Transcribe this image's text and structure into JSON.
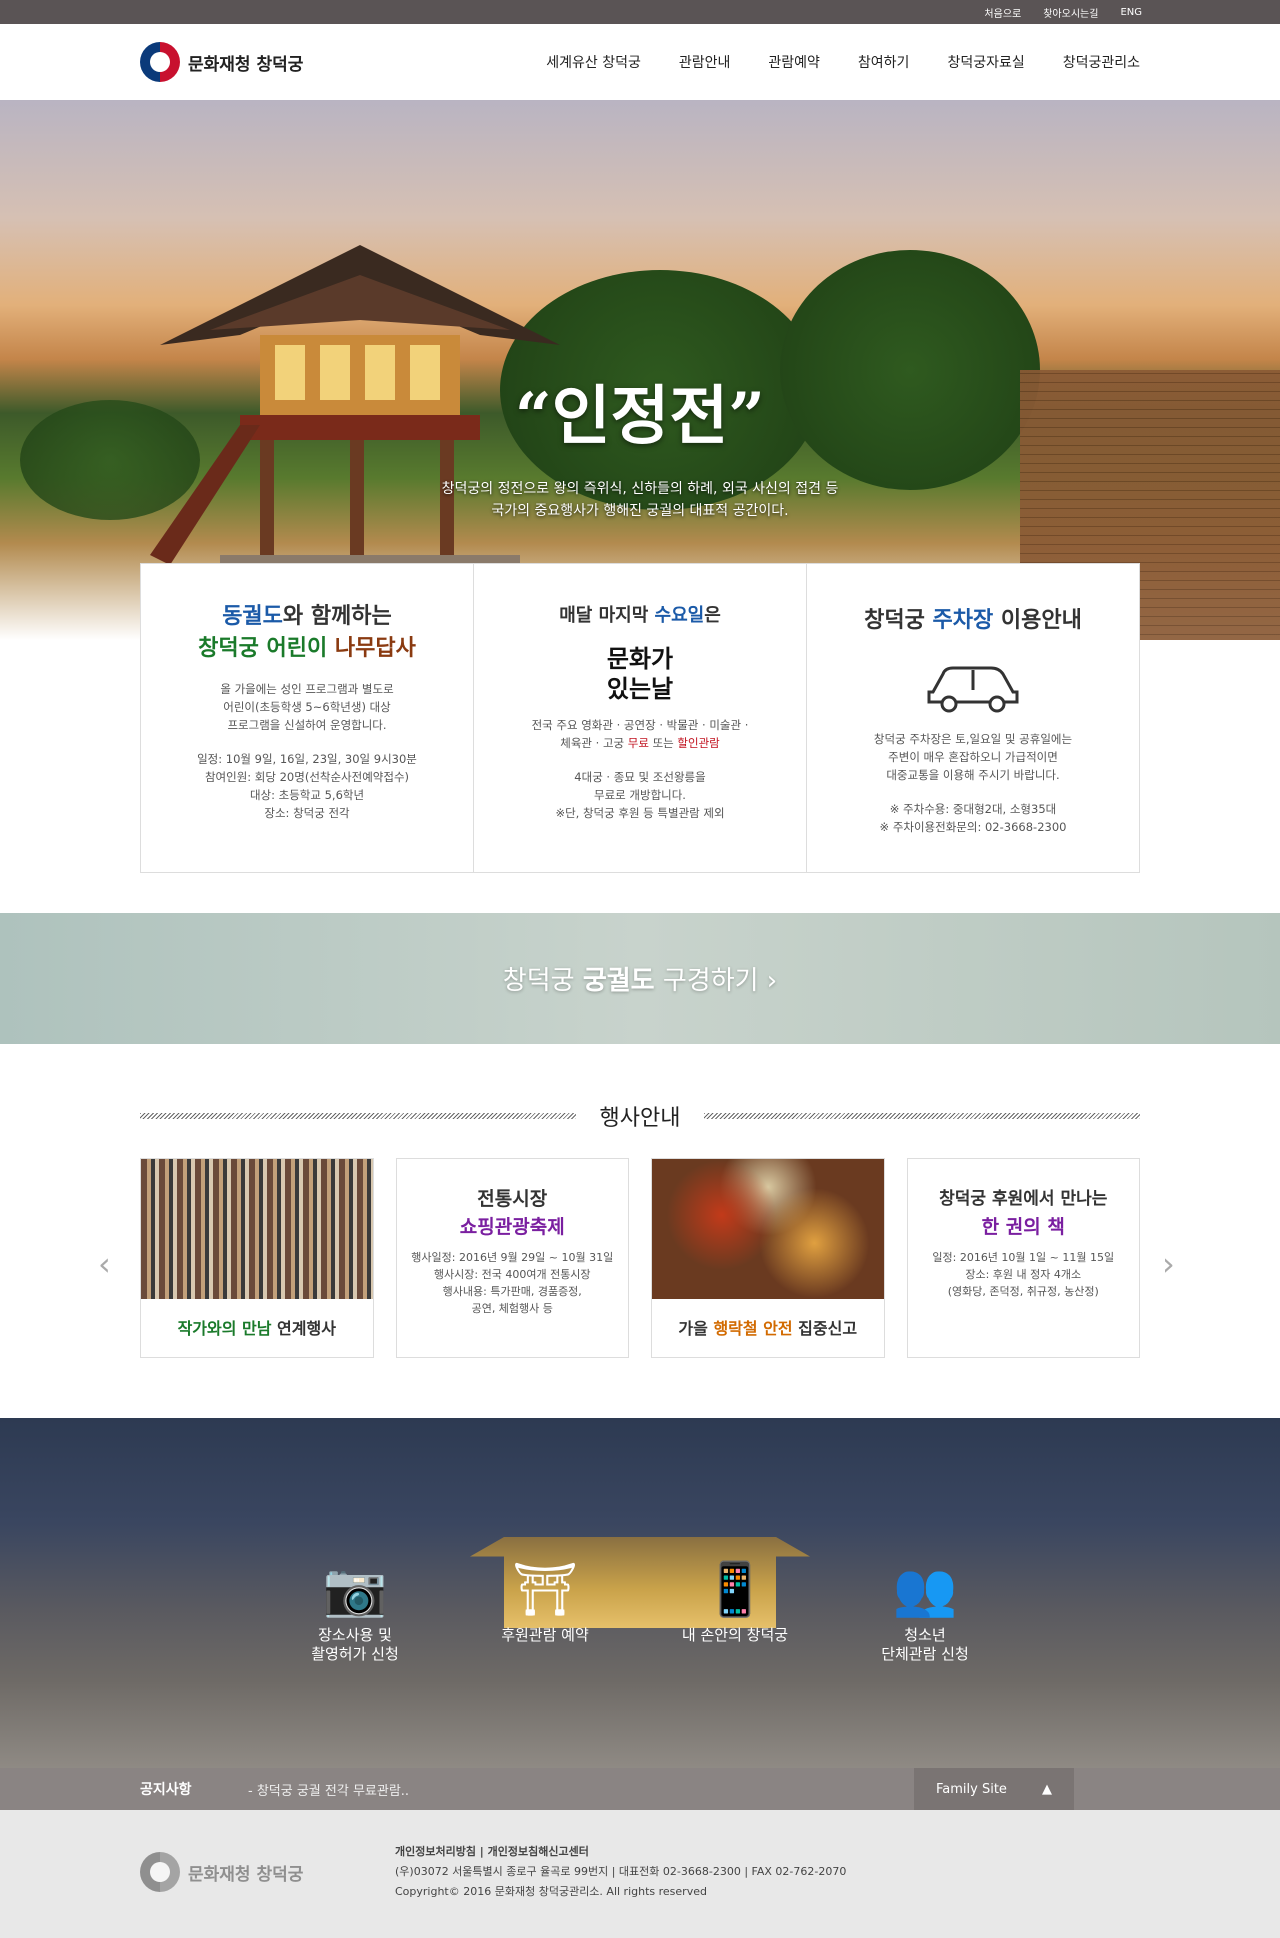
{
  "utility_links": [
    "처음으로",
    "찾아오시는길",
    "ENG"
  ],
  "logo": "문화재청 창덕궁",
  "nav": [
    "세계유산 창덕궁",
    "관람안내",
    "관람예약",
    "참여하기",
    "창덕궁자료실",
    "창덕궁관리소"
  ],
  "hero": {
    "title": "“인정전”",
    "desc1": "창덕궁의 정전으로 왕의 즉위식, 신하들의 하례, 외국 사신의 접견 등",
    "desc2": "국가의 중요행사가 행해진 궁궐의 대표적 공간이다."
  },
  "card1": {
    "t1a": "동궐도",
    "t1b": "와 함께하는",
    "t2a": "창덕궁 어린이 ",
    "t2b": "나무답사",
    "p1": "올 가을에는 성인 프로그램과 별도로",
    "p2": "어린이(초등학생 5~6학년생) 대상",
    "p3": "프로그램을 신설하여 운영합니다.",
    "p4": "일정: 10월 9일, 16일, 23일, 30일  9시30분",
    "p5": "참여인원: 회당 20명(선착순사전예약접수)",
    "p6": "대상: 초등학교 5,6학년",
    "p7": "장소: 창덕궁 전각"
  },
  "card2": {
    "t1": "매달 마지막 ",
    "t1b": "수요일",
    "t1c": "은",
    "logo": "문화가 있는날",
    "p1": "전국 주요 영화관 · 공연장 · 박물관 · 미술관 ·",
    "p2a": "체육관 · 고궁 ",
    "p2b": "무료",
    "p2c": " 또는 ",
    "p2d": "할인관람",
    "p3": "4대궁 · 종묘 및 조선왕릉을",
    "p4": "무료로 개방합니다.",
    "p5": "※단, 창덕궁 후원 등 특별관람 제외"
  },
  "card3": {
    "t1": "창덕궁 ",
    "t1b": "주차장",
    "t1c": " 이용안내",
    "p1": "창덕궁 주차장은 토,일요일 및 공휴일에는",
    "p2": "주변이 매우 혼잡하오니 가급적이면",
    "p3": "대중교통을 이용해 주시기 바랍니다.",
    "p4": "※ 주차수용: 중대형2대, 소형35대",
    "p5": "※ 주차이용전화문의: 02-3668-2300"
  },
  "banner": {
    "a": "창덕궁 ",
    "b": "궁궐도",
    "c": " 구경하기  ›"
  },
  "events_title": "행사안내",
  "ev1": {
    "a": "작가와의 만남",
    "b": " 연계행사"
  },
  "ev2": {
    "t1": "전통시장",
    "t2": "쇼핑관광축제",
    "p1": "행사일정: 2016년 9월 29일 ~ 10월 31일",
    "p2": "행사시장: 전국 400여개 전통시장",
    "p3": "행사내용: 특가판매, 경품증정,",
    "p4": "공연, 체험행사 등"
  },
  "ev3": {
    "a": "가을 ",
    "b": "행락철 안전",
    "c": " 집중신고"
  },
  "ev4": {
    "t1": "창덕궁 후원에서 만나는",
    "t2": "한 권의 책",
    "p1": "일정: 2016년 10월 1일 ~ 11월 15일",
    "p2": "장소: 후원 내 정자 4개소",
    "p3": "(영화당, 존덕정, 취규정, 농산정)"
  },
  "quick": [
    {
      "l1": "장소사용 및",
      "l2": "촬영허가 신청"
    },
    {
      "l1": "후원관람 예약",
      "l2": ""
    },
    {
      "l1": "내 손안의 창덕궁",
      "l2": ""
    },
    {
      "l1": "청소년",
      "l2": "단체관람 신청"
    }
  ],
  "notice": {
    "label": "공지사항",
    "text": "- 창덕궁 궁궐 전각 무료관람..",
    "family": "Family Site"
  },
  "footer": {
    "links": "개인정보처리방침   |   개인정보침해신고센터",
    "addr": "(우)03072 서울특별시 종로구 율곡로 99번지   |   대표전화 02-3668-2300   |   FAX 02-762-2070",
    "copy": "Copyright© 2016 문화재청 창덕궁관리소. All rights reserved"
  }
}
